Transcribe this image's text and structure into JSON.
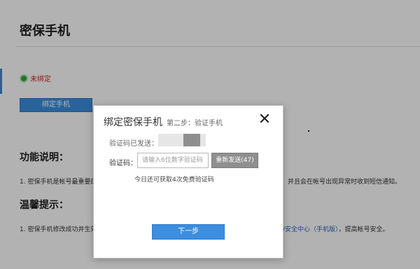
{
  "page": {
    "title": "密保手机",
    "status_text": "未绑定",
    "bind_button": "绑定手机",
    "section1_title": "功能说明：",
    "section1_text_left": "1. 密保手机是帐号最重要的",
    "section1_text_right": "，并且会在帐号出现异常时收到短信通知。",
    "section2_title": "温馨提示：",
    "section2_text_left": "1. 密保手机修改成功并生效",
    "section2_link": "/安全中心（手机版）",
    "section2_text_right": "，提高帐号安全。"
  },
  "modal": {
    "title": "绑定密保手机",
    "step": "第二步：验证手机",
    "sent_label": "验证码已发送：",
    "code_label": "验证码：",
    "code_placeholder": "请输入6位数字验证码",
    "resend_button": "重新发送(47)",
    "hint": "今日还可获取4次免费验证码",
    "next_button": "下一步"
  },
  "colors": {
    "primary": "#3d8ede",
    "status_red": "#d12a2a",
    "status_green": "#32a532",
    "resend_gray": "#8f8f8f"
  },
  "icons": [
    "status-dot-icon",
    "close-icon"
  ]
}
